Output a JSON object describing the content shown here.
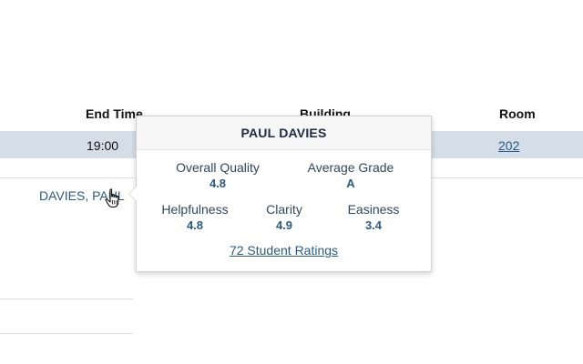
{
  "table": {
    "headers": {
      "end_time": "End Time",
      "building": "Building",
      "room": "Room"
    },
    "row": {
      "end_time": "19:00",
      "room": "202",
      "instructor": "DAVIES, PAUL"
    }
  },
  "popover": {
    "title": "PAUL DAVIES",
    "stats": {
      "overall_quality": {
        "label": "Overall Quality",
        "value": "4.8"
      },
      "average_grade": {
        "label": "Average Grade",
        "value": "A"
      },
      "helpfulness": {
        "label": "Helpfulness",
        "value": "4.8"
      },
      "clarity": {
        "label": "Clarity",
        "value": "4.9"
      },
      "easiness": {
        "label": "Easiness",
        "value": "3.4"
      }
    },
    "ratings_link": "72 Student Ratings"
  },
  "colors": {
    "link": "#2a5a85",
    "row_highlight": "#d5dee8",
    "popover_title": "#1c2a45"
  },
  "icons": {
    "cursor": "hand-pointer-icon"
  }
}
